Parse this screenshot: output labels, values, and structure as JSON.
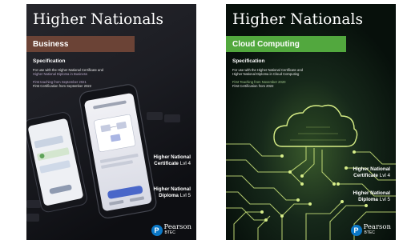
{
  "covers": [
    {
      "title": "Higher Nationals",
      "subject": "Business",
      "spec_heading": "Specification",
      "lines": [
        "For use with the Higher National Certificate and",
        "Higher National Diploma in Business",
        "First teaching from September 2021",
        "First Certification from September 2022"
      ],
      "qual1_title": "Higher National",
      "qual1_sub": "Certificate",
      "qual1_level": "Lvl 4",
      "qual2_title": "Higher National",
      "qual2_sub": "Diploma",
      "qual2_level": "Lvl 5",
      "logo_letter": "P",
      "logo_brand": "Pearson",
      "logo_sub": "BTEC",
      "band_color": "#6b4336"
    },
    {
      "title": "Higher Nationals",
      "subject": "Cloud Computing",
      "spec_heading": "Specification",
      "lines": [
        "For use with the Higher National Certificate and",
        "Higher National Diploma in Cloud Computing",
        "First Teaching from November 2020",
        "First Certification from 2022"
      ],
      "qual1_title": "Higher National",
      "qual1_sub": "Certificate",
      "qual1_level": "Lvl 4",
      "qual2_title": "Higher National",
      "qual2_sub": "Diploma",
      "qual2_level": "Lvl 5",
      "logo_letter": "P",
      "logo_brand": "Pearson",
      "logo_sub": "BTEC",
      "band_color": "#52a83e"
    }
  ]
}
